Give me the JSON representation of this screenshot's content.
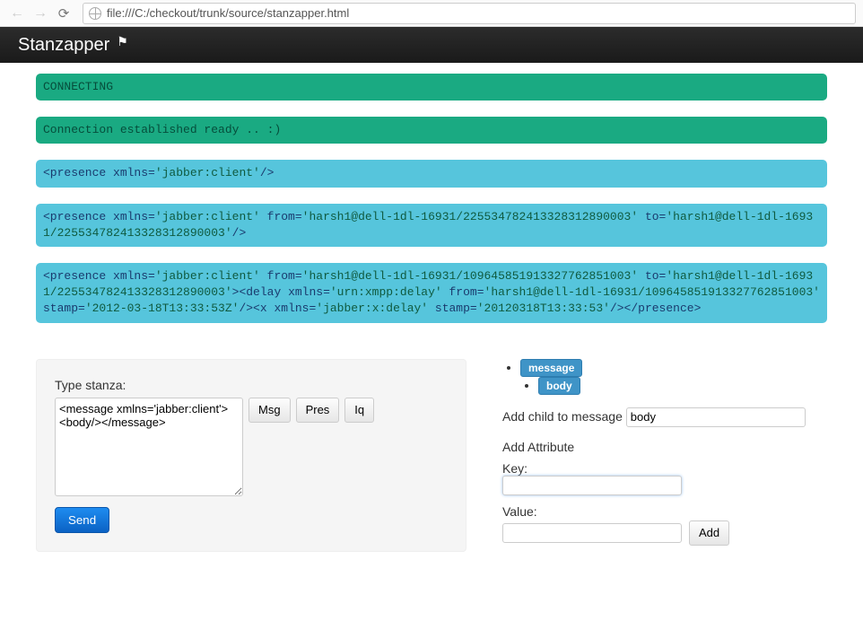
{
  "browser": {
    "url": "file:///C:/checkout/trunk/source/stanzapper.html"
  },
  "app": {
    "title": "Stanzapper",
    "flag": "⚑"
  },
  "logs": [
    {
      "kind": "green",
      "text": "CONNECTING"
    },
    {
      "kind": "green",
      "text": "Connection established ready .. :)"
    },
    {
      "kind": "cyan",
      "html_segments": [
        {
          "t": "elem",
          "v": "<presence "
        },
        {
          "t": "attr",
          "v": "xmlns="
        },
        {
          "t": "val",
          "v": "'jabber:client'"
        },
        {
          "t": "elem",
          "v": "/>"
        }
      ]
    },
    {
      "kind": "cyan",
      "html_segments": [
        {
          "t": "elem",
          "v": "<presence "
        },
        {
          "t": "attr",
          "v": "xmlns="
        },
        {
          "t": "val",
          "v": "'jabber:client' "
        },
        {
          "t": "attr",
          "v": "from="
        },
        {
          "t": "val",
          "v": "'harsh1@dell-1dl-16931/225534782413328312890003' "
        },
        {
          "t": "attr",
          "v": "to="
        },
        {
          "t": "val",
          "v": "'harsh1@dell-1dl-16931/225534782413328312890003'"
        },
        {
          "t": "elem",
          "v": "/>"
        }
      ]
    },
    {
      "kind": "cyan",
      "html_segments": [
        {
          "t": "elem",
          "v": "<presence "
        },
        {
          "t": "attr",
          "v": "xmlns="
        },
        {
          "t": "val",
          "v": "'jabber:client' "
        },
        {
          "t": "attr",
          "v": "from="
        },
        {
          "t": "val",
          "v": "'harsh1@dell-1dl-16931/109645851913327762851003' "
        },
        {
          "t": "attr",
          "v": "to="
        },
        {
          "t": "val",
          "v": "'harsh1@dell-1dl-16931/225534782413328312890003'"
        },
        {
          "t": "elem",
          "v": "><delay "
        },
        {
          "t": "attr",
          "v": "xmlns="
        },
        {
          "t": "val",
          "v": "'urn:xmpp:delay' "
        },
        {
          "t": "attr",
          "v": "from="
        },
        {
          "t": "val",
          "v": "'harsh1@dell-1dl-16931/109645851913327762851003' "
        },
        {
          "t": "attr",
          "v": "stamp="
        },
        {
          "t": "val",
          "v": "'2012-03-18T13:33:53Z'"
        },
        {
          "t": "elem",
          "v": "/><x "
        },
        {
          "t": "attr",
          "v": "xmlns="
        },
        {
          "t": "val",
          "v": "'jabber:x:delay' "
        },
        {
          "t": "attr",
          "v": "stamp="
        },
        {
          "t": "val",
          "v": "'20120318T13:33:53'"
        },
        {
          "t": "elem",
          "v": "/></presence>"
        }
      ]
    }
  ],
  "compose": {
    "label": "Type stanza:",
    "textarea_value": "<message xmlns='jabber:client'><body/></message>",
    "btn_msg": "Msg",
    "btn_pres": "Pres",
    "btn_iq": "Iq",
    "btn_send": "Send"
  },
  "tree": {
    "root": "message",
    "child": "body"
  },
  "add_child": {
    "label": "Add child to message",
    "value": "body"
  },
  "add_attr": {
    "heading": "Add Attribute",
    "key_label": "Key:",
    "key_value": "",
    "value_label": "Value:",
    "value_value": "",
    "btn_add": "Add"
  }
}
